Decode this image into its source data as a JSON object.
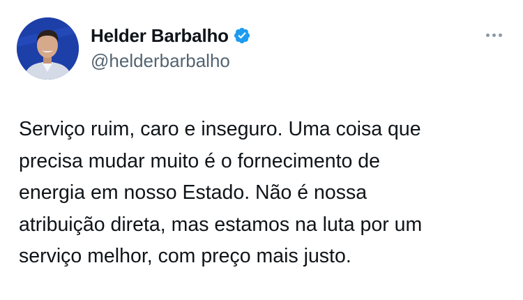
{
  "tweet": {
    "author": {
      "display_name": "Helder Barbalho",
      "handle": "@helderbarbalho",
      "verified": true
    },
    "text_lines": [
      "Serviço ruim, caro e inseguro. Uma coisa que",
      "precisa mudar muito é o fornecimento de",
      "energia em nosso Estado. Não é nossa",
      "atribuição direta, mas estamos na luta por um",
      "serviço melhor, com preço mais justo."
    ]
  },
  "icons": {
    "avatar": "profile-photo",
    "verified": "verified-badge-icon",
    "more": "more-options-icon"
  },
  "colors": {
    "background": "#ffffff",
    "text": "#0f1419",
    "handle": "#536471",
    "verified_badge": "#1d9bf0",
    "more_icon": "#8b98a5",
    "avatar_background": "#1d3fa8"
  }
}
